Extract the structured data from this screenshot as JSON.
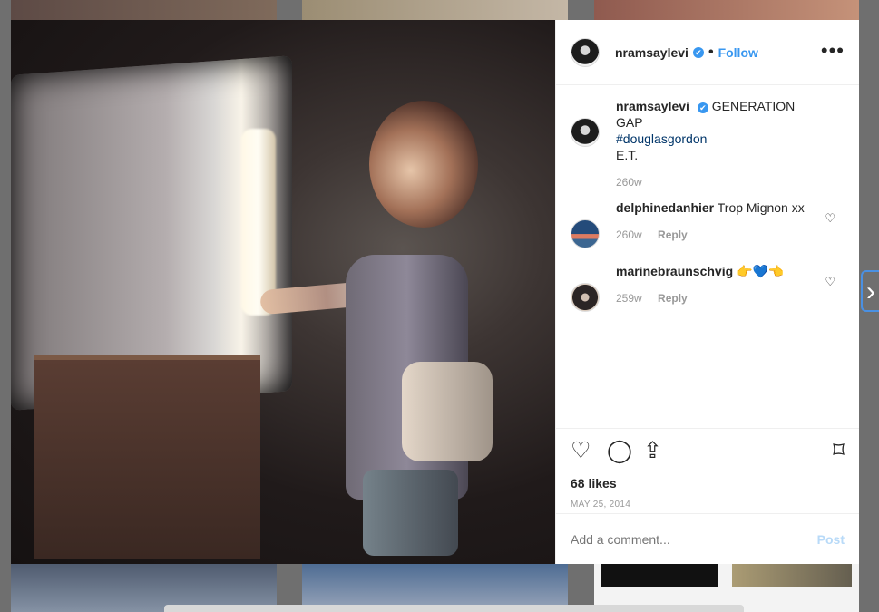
{
  "post": {
    "username": "nramsaylevi",
    "follow_label": "Follow",
    "more_label": "•••",
    "caption_user": "nramsaylevi",
    "caption_text": "GENERATION GAP",
    "hashtag": "#douglasgordon",
    "caption_extra": "E.T.",
    "caption_age": "260w"
  },
  "comments": [
    {
      "user": "delphinedanhier",
      "text": "Trop Mignon xx",
      "age": "260w",
      "reply": "Reply"
    },
    {
      "user": "marinebraunschvig",
      "text": "👉💙👈",
      "age": "259w",
      "reply": "Reply"
    }
  ],
  "actions": {
    "likes": "68 likes",
    "date": "MAY 25, 2014"
  },
  "comment_box": {
    "placeholder": "Add a comment...",
    "post_label": "Post"
  },
  "navigation": {
    "next_label": "›"
  },
  "icons": {
    "verified": "✔",
    "like": "♡",
    "comment": "◯",
    "share": "⇪",
    "save": "⌑",
    "heart": "♡"
  },
  "colors": {
    "accent": "#3897f0",
    "text": "#262626",
    "muted": "#999999",
    "post_disabled": "#b8daf8"
  }
}
